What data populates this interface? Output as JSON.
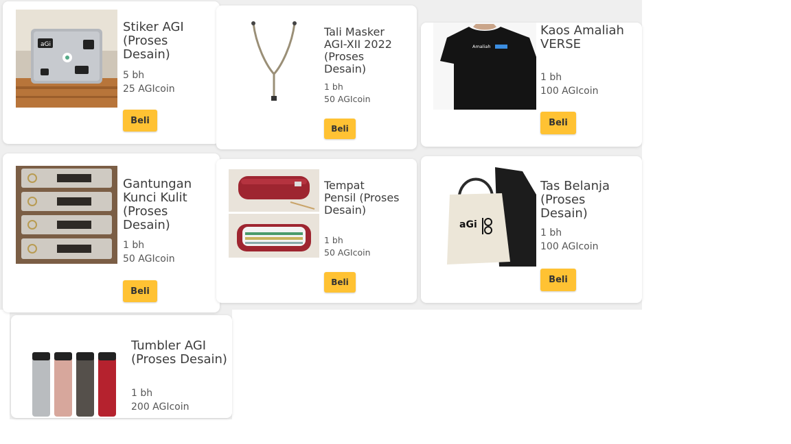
{
  "products": [
    {
      "title": "Stiker AGI (Proses Desain)",
      "qty": "5 bh",
      "price": "25 AGIcoin",
      "buy_label": "Beli",
      "image_icon": "laptop-stickers-image"
    },
    {
      "title": "Tali Masker AGI-XII 2022 (Proses Desain)",
      "qty": "1 bh",
      "price": "50 AGIcoin",
      "buy_label": "Beli",
      "image_icon": "mask-strap-image"
    },
    {
      "title": "Kaos Amaliah VERSE",
      "qty": "1 bh",
      "price": "100 AGIcoin",
      "buy_label": "Beli",
      "image_icon": "tshirt-image",
      "shirt_text": "Amaliah"
    },
    {
      "title": "Gantungan Kunci Kulit (Proses Desain)",
      "qty": "1 bh",
      "price": "50 AGIcoin",
      "buy_label": "Beli",
      "image_icon": "keychain-image"
    },
    {
      "title": "Tempat Pensil (Proses Desain)",
      "qty": "1 bh",
      "price": "50 AGIcoin",
      "buy_label": "Beli",
      "image_icon": "pencil-case-image"
    },
    {
      "title": "Tas Belanja (Proses Desain)",
      "qty": "1 bh",
      "price": "100 AGIcoin",
      "buy_label": "Beli",
      "image_icon": "tote-bag-image"
    },
    {
      "title": "Tumbler AGI (Proses Desain)",
      "qty": "1 bh",
      "price": "200 AGIcoin",
      "buy_label": "",
      "image_icon": "tumbler-image"
    }
  ],
  "colors": {
    "button": "#ffc233",
    "card_bg": "#ffffff",
    "panel_bg": "#efefef"
  }
}
